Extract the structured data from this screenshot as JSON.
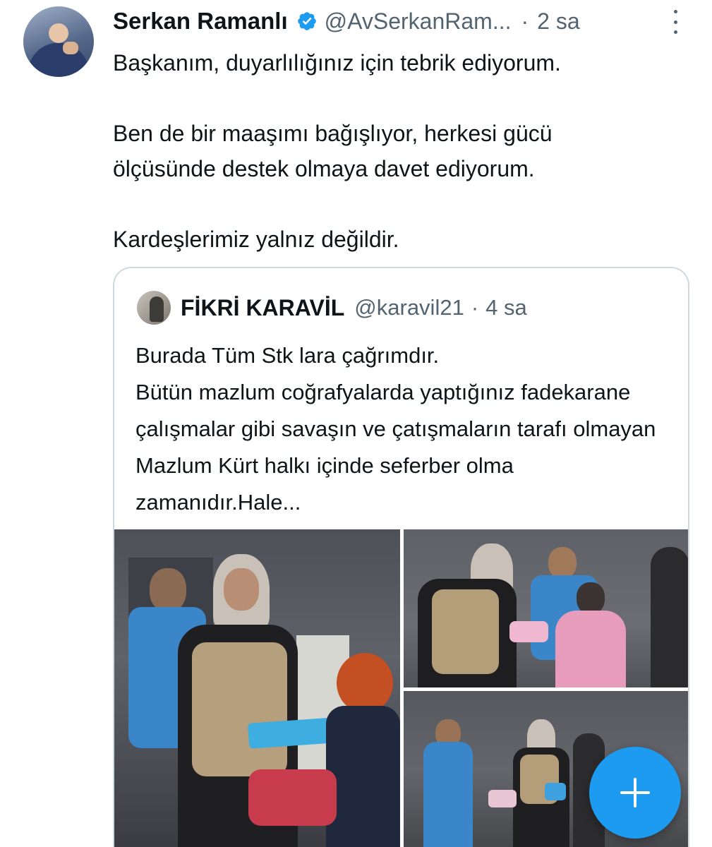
{
  "tweet": {
    "author_name": "Serkan Ramanlı",
    "verified_icon": "verified-badge-icon",
    "handle": "@AvSerkanRam...",
    "separator": "·",
    "time": "2 sa",
    "paragraphs": [
      "Başkanım, duyarlılığınız için tebrik ediyorum.",
      "Ben de bir maaşımı bağışlıyor, herkesi gücü ölçüsünde destek olmaya davet ediyorum.",
      "Kardeşlerimiz yalnız değildir."
    ]
  },
  "quote": {
    "author_name": "FİKRİ KARAVİL",
    "handle": "@karavil21",
    "separator": "·",
    "time": "4 sa",
    "text": "Burada Tüm Stk lara çağrımdır.\nBütün mazlum coğrafyalarda yaptığınız fadekarane çalışmalar gibi savaşın ve çatışmaların tarafı olmayan Mazlum Kürt halkı içinde seferber olma zamanıdır.Hale..."
  },
  "colors": {
    "accent": "#1d9bf0",
    "secondary_text": "#536471",
    "border": "#cfd9de"
  },
  "fab": {
    "icon": "plus-icon"
  }
}
